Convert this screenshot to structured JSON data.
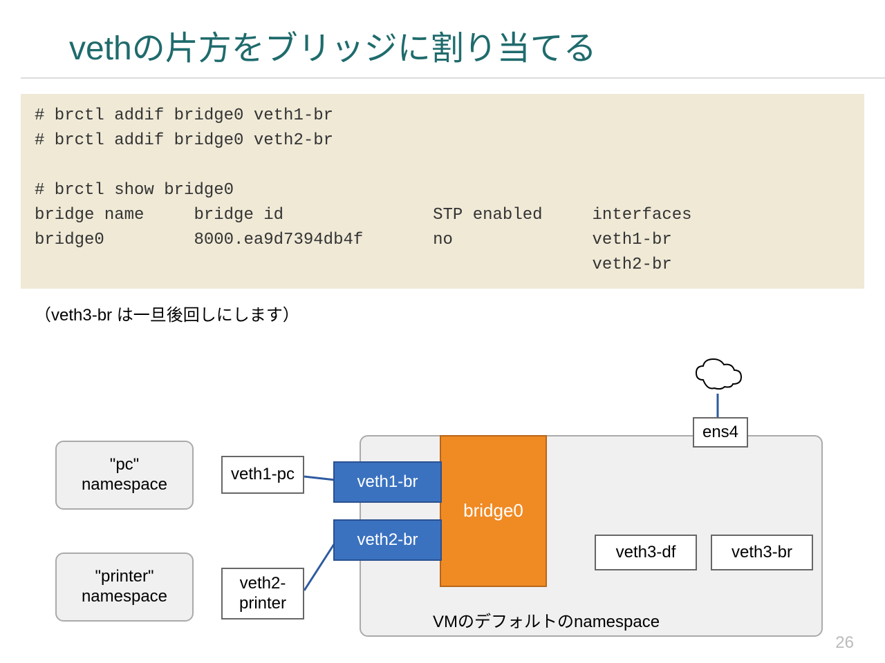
{
  "title": "vethの片方をブリッジに割り当てる",
  "code": "# brctl addif bridge0 veth1-br\n# brctl addif bridge0 veth2-br\n\n# brctl show bridge0\nbridge name     bridge id               STP enabled     interfaces\nbridge0         8000.ea9d7394db4f       no              veth1-br\n                                                        veth2-br",
  "note": "（veth3-br は一旦後回しにします）",
  "diagram": {
    "pc_ns": "\"pc\"\nnamespace",
    "printer_ns": "\"printer\"\nnamespace",
    "veth1_pc": "veth1-pc",
    "veth2_printer": "veth2-\nprinter",
    "veth1_br": "veth1-br",
    "veth2_br": "veth2-br",
    "bridge0": "bridge0",
    "veth3_df": "veth3-df",
    "veth3_br": "veth3-br",
    "ens4": "ens4",
    "vm_label": "VMのデフォルトのnamespace"
  },
  "page": "26"
}
